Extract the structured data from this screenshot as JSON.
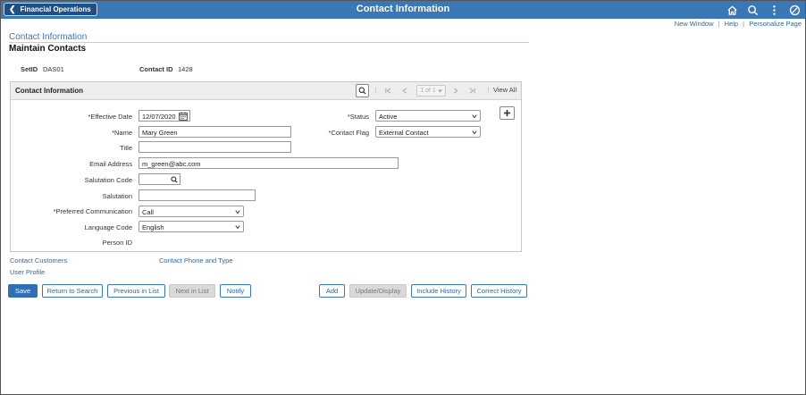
{
  "header": {
    "back_label": "Financial Operations",
    "title": "Contact Information",
    "icons": [
      "home-icon",
      "search-icon",
      "actions-menu-icon",
      "navbar-icon"
    ]
  },
  "top_links": {
    "new_window": "New Window",
    "help": "Help",
    "personalize": "Personalize Page",
    "sep": "|"
  },
  "page": {
    "title": "Contact Information",
    "subtitle": "Maintain Contacts"
  },
  "keys": {
    "setid_label": "SetID",
    "setid_value": "DAS01",
    "contact_id_label": "Contact ID",
    "contact_id_value": "1428"
  },
  "panel": {
    "title": "Contact Information",
    "pager": "1 of 1",
    "view_all": "View All"
  },
  "form": {
    "effective_date_label": "*Effective Date",
    "effective_date_value": "12/07/2020",
    "name_label": "*Name",
    "name_value": "Mary Green",
    "title_label": "Title",
    "title_value": "",
    "email_label": "Email Address",
    "email_value": "m_green@abc.com",
    "salutation_code_label": "Salutation Code",
    "salutation_code_value": "",
    "salutation_label": "Salutation",
    "salutation_value": "",
    "pref_comm_label": "*Preferred Communication",
    "pref_comm_value": "Call",
    "language_label": "Language Code",
    "language_value": "English",
    "person_id_label": "Person ID",
    "person_id_value": "",
    "status_label": "*Status",
    "status_value": "Active",
    "contact_flag_label": "*Contact Flag",
    "contact_flag_value": "External Contact"
  },
  "links": {
    "contact_customers": "Contact Customers",
    "contact_phone": "Contact Phone and Type",
    "user_profile": "User Profile"
  },
  "buttons": {
    "save": "Save",
    "return_to_search": "Return to Search",
    "previous_in_list": "Previous in List",
    "next_in_list": "Next in List",
    "notify": "Notify",
    "add": "Add",
    "update_display": "Update/Display",
    "include_history": "Include History",
    "correct_history": "Correct History"
  },
  "colors": {
    "header_bg": "#3a77b6",
    "back_button_bg": "#1e4f86",
    "primary_button": "#2f6fb4",
    "link": "#2d6aa8"
  }
}
